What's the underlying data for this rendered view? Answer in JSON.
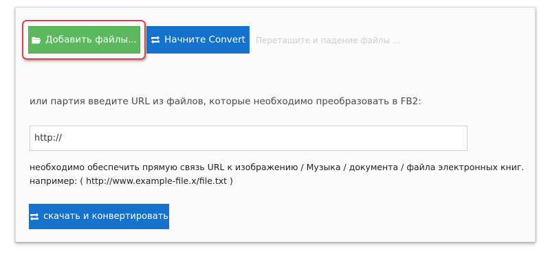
{
  "upload": {
    "add_files_label": "Добавить файлы...",
    "start_convert_label": "Начните Convert",
    "drop_hint": "Перетащите и падение файлы ..."
  },
  "url_section": {
    "prompt": "или партия введите URL из файлов, которые необходимо преобразовать в FB2:",
    "input_value": "http://",
    "note_line1": "необходимо обеспечить прямую связь URL к изображению / Музыка / документа / файла электронных книг.",
    "note_line2": "например: ( http://www.example-file.x/file.txt )",
    "download_convert_label": "скачать и конвертировать"
  },
  "icons": {
    "folder": "folder-open-icon",
    "refresh": "refresh-icon"
  },
  "colors": {
    "green_button": "#5cb85c",
    "blue_button": "#1572cc",
    "highlight": "#d64545"
  }
}
